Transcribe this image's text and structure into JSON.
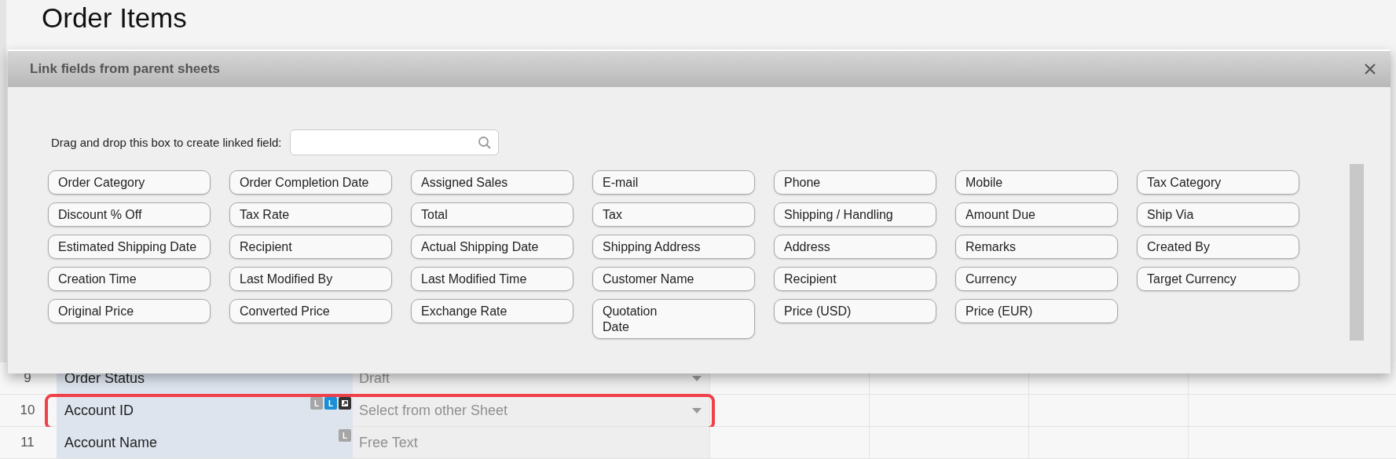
{
  "page": {
    "title": "Order Items"
  },
  "dialog": {
    "title": "Link fields from parent sheets",
    "search": {
      "label": "Drag and drop this box to create linked field:"
    },
    "fields": [
      "Order Category",
      "Order Completion Date",
      "Assigned Sales",
      "E-mail",
      "Phone",
      "Mobile",
      "Tax Category",
      "Discount % Off",
      "Tax Rate",
      "Total",
      "Tax",
      "Shipping / Handling",
      "Amount Due",
      "Ship Via",
      "Estimated Shipping Date",
      "Recipient",
      "Actual Shipping Date",
      "Shipping Address",
      "Address",
      "Remarks",
      "Created By",
      "Creation Time",
      "Last Modified By",
      "Last Modified Time",
      "Customer Name",
      "Recipient",
      "Currency",
      "Target Currency",
      "Original Price",
      "Converted Price",
      "Exchange Rate",
      "Quotation\nDate",
      "Price (USD)",
      "Price (EUR)"
    ]
  },
  "rows": [
    {
      "number": "9",
      "name": "Order Status",
      "badges": [],
      "value": "Draft",
      "dropdown": true,
      "highlighted": false
    },
    {
      "number": "10",
      "name": "Account ID",
      "badges": [
        {
          "kind": "letter",
          "text": "L",
          "color": "#a6a6a6"
        },
        {
          "kind": "letter",
          "text": "L",
          "color": "#1a8fd6"
        },
        {
          "kind": "link",
          "color": "#333333"
        }
      ],
      "value": "Select from other Sheet",
      "dropdown": true,
      "highlighted": true
    },
    {
      "number": "11",
      "name": "Account Name",
      "badges": [
        {
          "kind": "letter",
          "text": "L",
          "color": "#a6a6a6"
        }
      ],
      "value": "Free Text",
      "dropdown": false,
      "highlighted": false
    }
  ]
}
